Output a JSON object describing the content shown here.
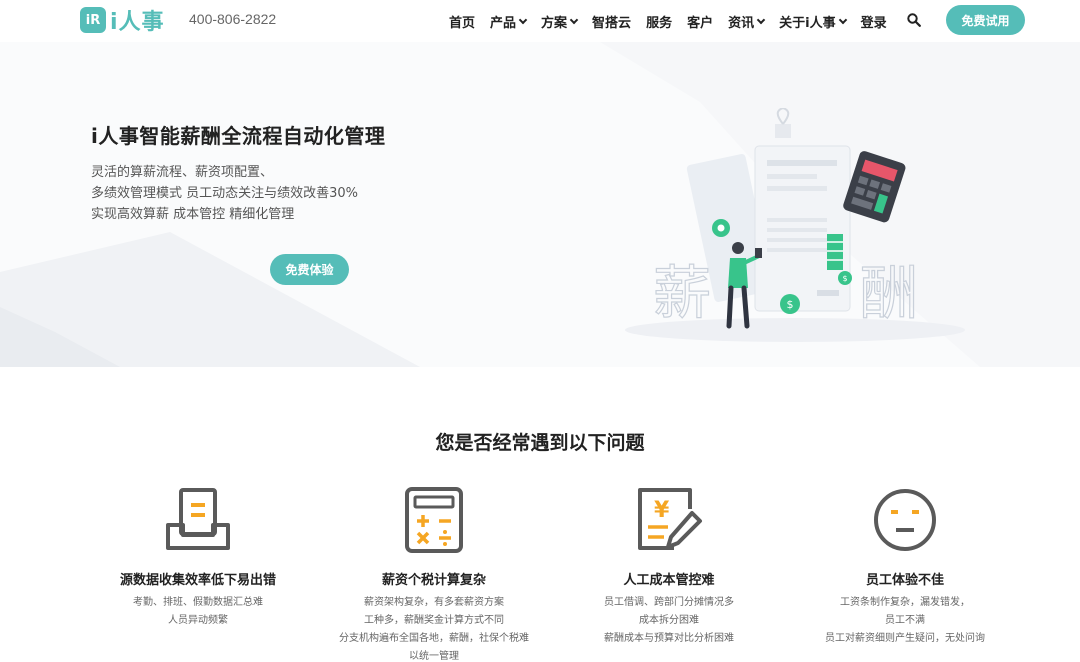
{
  "header": {
    "logo_badge": "iR",
    "logo_text": "i人事",
    "phone": "400-806-2822",
    "menu": [
      {
        "label": "首页",
        "dropdown": false
      },
      {
        "label": "产品",
        "dropdown": true
      },
      {
        "label": "方案",
        "dropdown": true
      },
      {
        "label": "智搭云",
        "dropdown": false
      },
      {
        "label": "服务",
        "dropdown": false
      },
      {
        "label": "客户",
        "dropdown": false
      },
      {
        "label": "资讯",
        "dropdown": true
      },
      {
        "label": "关于i人事",
        "dropdown": true
      },
      {
        "label": "登录",
        "dropdown": false
      }
    ],
    "search_icon": "search-icon",
    "trial_button": "免费试用"
  },
  "hero": {
    "title": "i人事智能薪酬全流程自动化管理",
    "lines": [
      "灵活的算薪流程、薪资项配置、",
      "多绩效管理模式 员工动态关注与绩效改善30%",
      "实现高效算薪 成本管控 精细化管理"
    ],
    "cta": "免费体验",
    "illustration_words": [
      "薪",
      "酬"
    ]
  },
  "problems": {
    "title": "您是否经常遇到以下问题",
    "cards": [
      {
        "icon": "inbox-document-icon",
        "title": "源数据收集效率低下易出错",
        "desc": [
          "考勤、排班、假勤数据汇总难",
          "人员异动频繁"
        ]
      },
      {
        "icon": "calculator-icon",
        "title": "薪资个税计算复杂",
        "desc": [
          "薪资架构复杂，有多套薪资方案",
          "工种多，薪酬奖金计算方式不同",
          "分支机构遍布全国各地，薪酬，社保个税难",
          "以统一管理"
        ]
      },
      {
        "icon": "cost-edit-icon",
        "title": "人工成本管控难",
        "desc": [
          "员工借调、跨部门分摊情况多",
          "成本拆分困难",
          "薪酬成本与预算对比分析困难"
        ]
      },
      {
        "icon": "neutral-face-icon",
        "title": "员工体验不佳",
        "desc": [
          "工资条制作复杂，漏发错发，",
          "员工不满",
          "员工对薪资细则产生疑问，无处问询"
        ]
      }
    ]
  },
  "colors": {
    "accent": "#55bdb8",
    "icon_gray": "#5a5a5a",
    "icon_orange": "#f5a623"
  }
}
